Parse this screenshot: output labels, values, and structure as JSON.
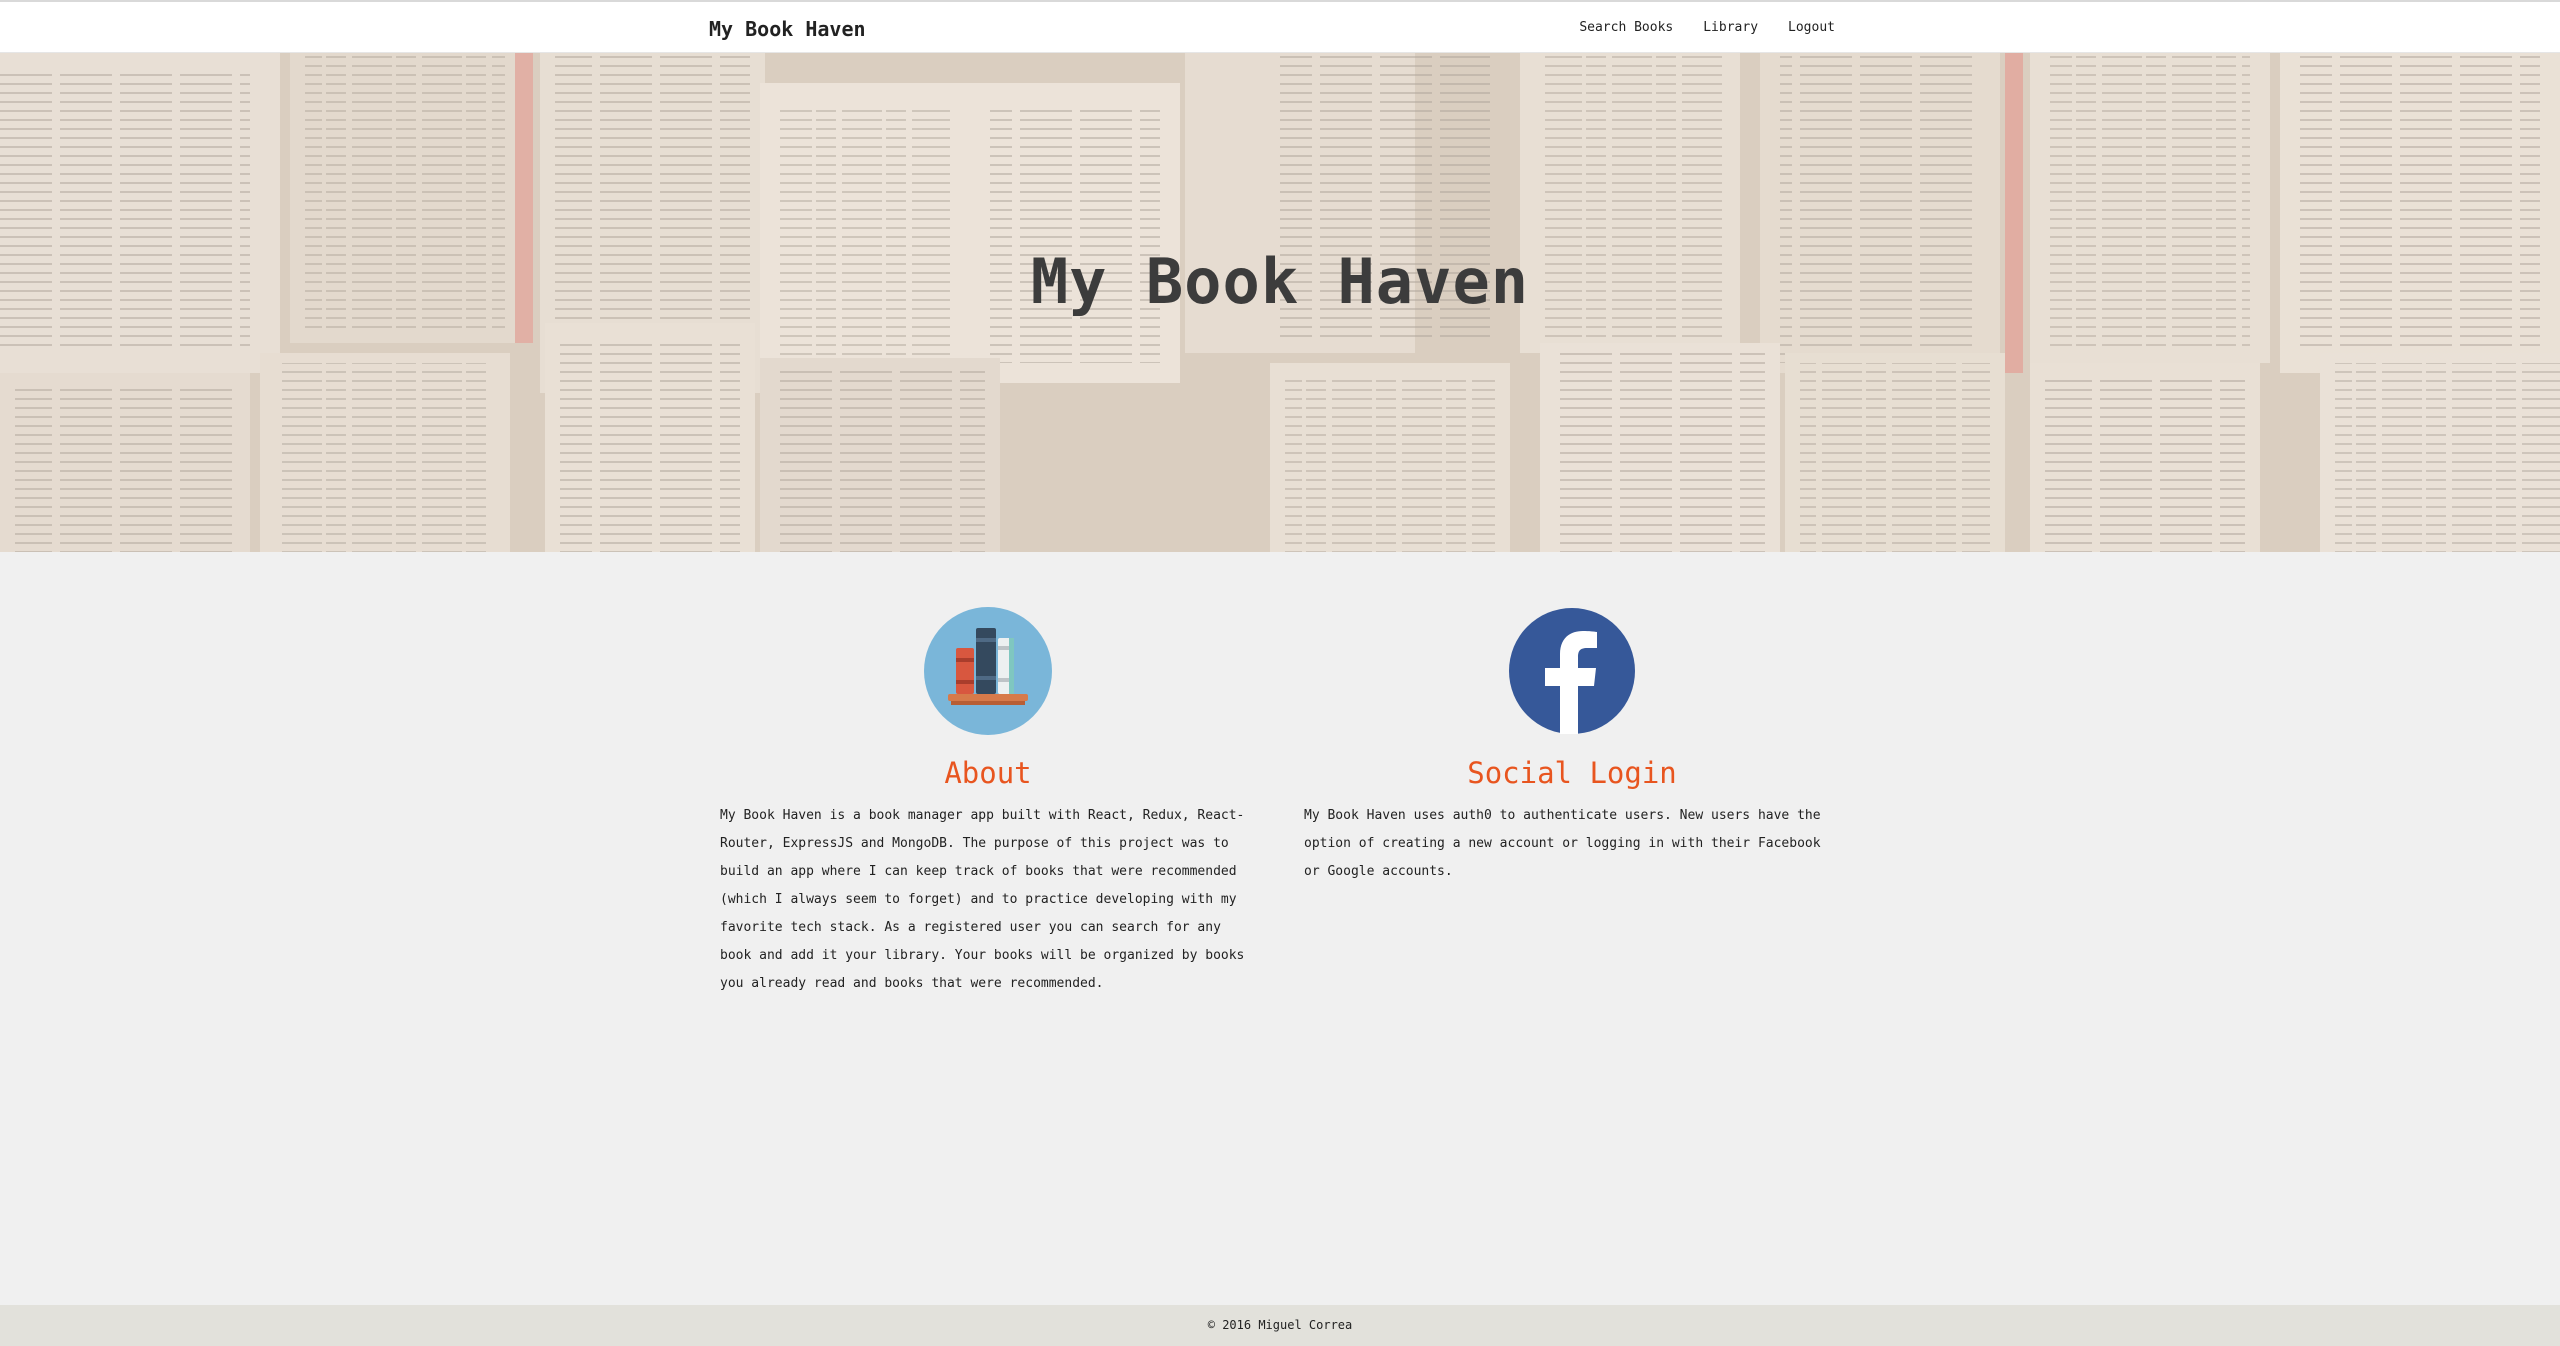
{
  "navbar": {
    "brand": "My Book Haven",
    "links": [
      {
        "label": "Search Books"
      },
      {
        "label": "Library"
      },
      {
        "label": "Logout"
      }
    ]
  },
  "hero": {
    "title": "My Book Haven",
    "background": "open-books-photo"
  },
  "features": {
    "about": {
      "icon": "books-icon",
      "heading": "About",
      "text": "My Book Haven is a book manager app built with React, Redux, React-Router, ExpressJS and MongoDB. The purpose of this project was to build an app where I can keep track of books that were recommended (which I always seem to forget) and to practice developing with my favorite tech stack. As a registered user you can search for any book and add it your library. Your books will be organized by books you already read and books that were recommended."
    },
    "social": {
      "icon": "facebook-icon",
      "heading": "Social Login",
      "text": "My Book Haven uses auth0 to authenticate users. New users have the option of creating a new account or logging in with their Facebook or Google accounts."
    }
  },
  "footer": {
    "text": "© 2016 Miguel Correa"
  },
  "colors": {
    "accent": "#e8551f",
    "navbar_bg": "#ffffff",
    "page_bg": "#f0f0f0",
    "footer_bg": "#e2e1db",
    "about_icon_bg": "#7ab6d9",
    "facebook_blue": "#365899"
  }
}
